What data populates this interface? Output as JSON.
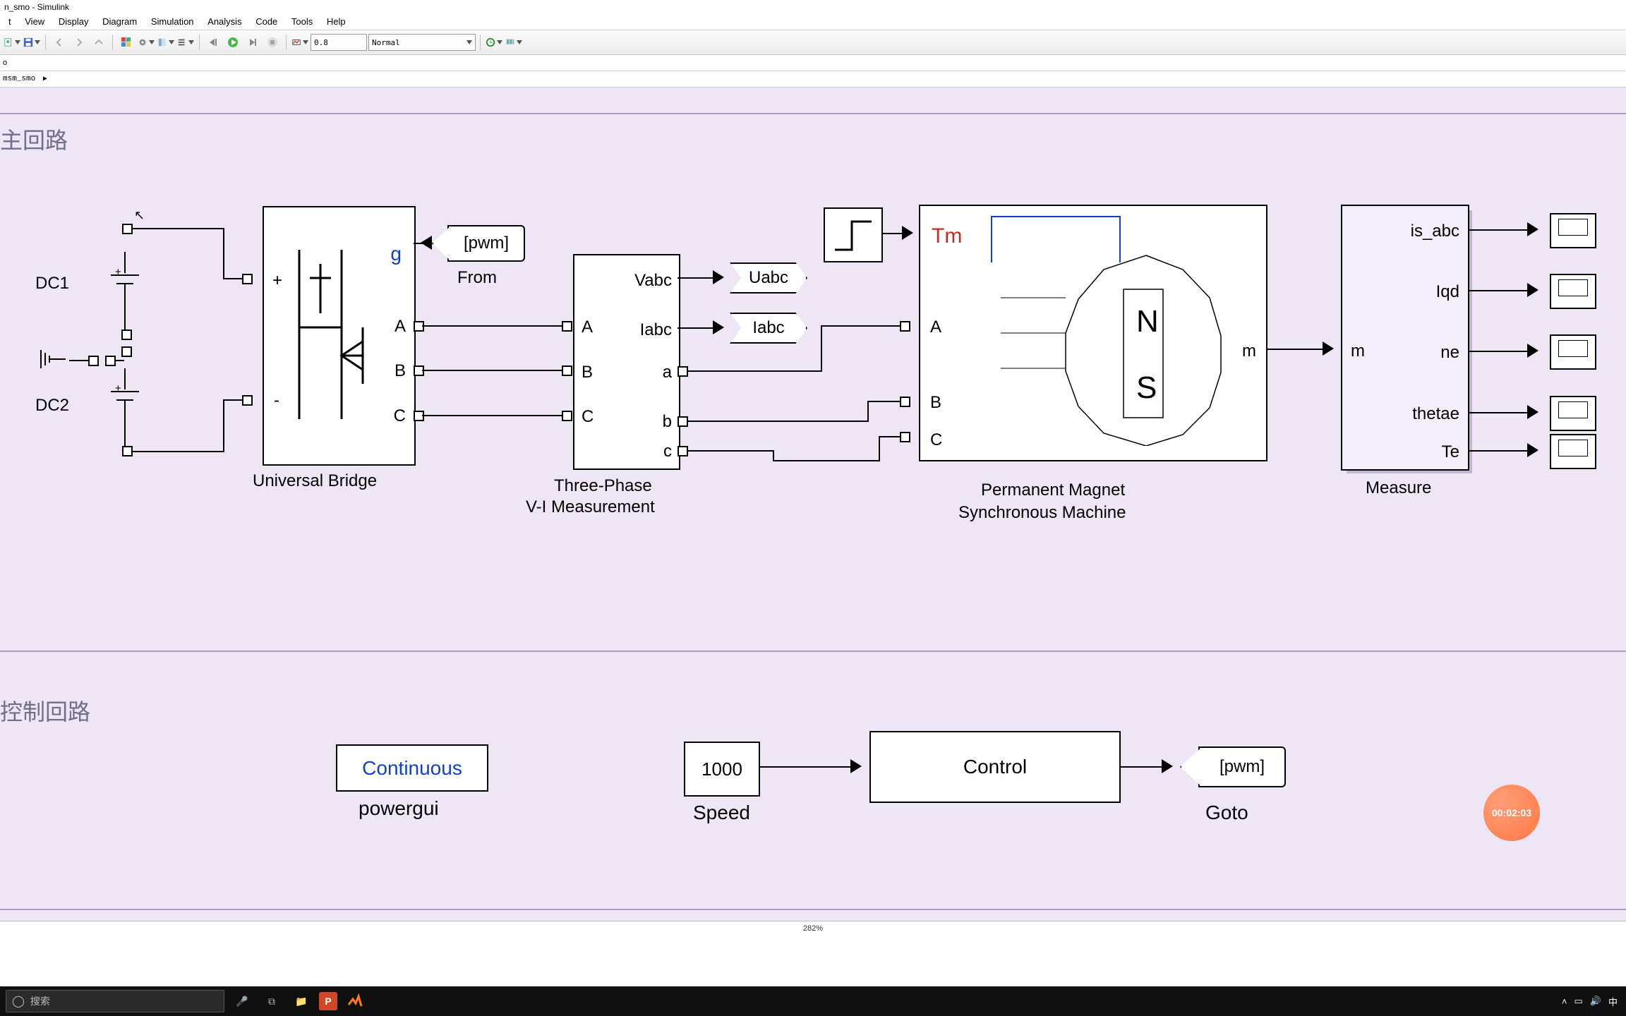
{
  "window": {
    "title": "n_smo - Simulink"
  },
  "menus": {
    "edit": "t",
    "view": "View",
    "display": "Display",
    "diagram": "Diagram",
    "simulation": "Simulation",
    "analysis": "Analysis",
    "code": "Code",
    "tools": "Tools",
    "help": "Help"
  },
  "toolbar": {
    "stop_time": "0.8",
    "mode": "Normal"
  },
  "tab": {
    "name": "o"
  },
  "breadcrumb": {
    "model": "msm_smo"
  },
  "status": {
    "zoom": "282%"
  },
  "regions": {
    "main": "主回路",
    "ctrl": "控制回路"
  },
  "labels": {
    "DC1": "DC1",
    "DC2": "DC2",
    "UniversalBridge": "Universal Bridge",
    "ThreeLine1": "Three-Phase",
    "ThreeLine2": "V-I Measurement",
    "PM1": "Permanent Magnet",
    "PM2": "Synchronous Machine",
    "Measure": "Measure",
    "powergui": "powergui",
    "Speed": "Speed",
    "Goto": "Goto",
    "From": "From"
  },
  "blocks": {
    "bridge": {
      "g": "g",
      "plus": "+",
      "minus": "-",
      "A": "A",
      "B": "B",
      "C": "C"
    },
    "vi": {
      "Vabc": "Vabc",
      "Iabc": "Iabc",
      "A": "A",
      "B": "B",
      "C": "C",
      "a": "a",
      "b": "b",
      "c": "c"
    },
    "pmsm": {
      "A": "A",
      "B": "B",
      "C": "C",
      "Tm": "Tm",
      "m": "m"
    },
    "measure": {
      "m": "m",
      "is_abc": "is_abc",
      "Iqd": "Iqd",
      "ne": "ne",
      "thetae": "thetae",
      "Te": "Te"
    },
    "powergui": "Continuous",
    "speed": "1000",
    "control": "Control"
  },
  "tags": {
    "pwm_from": "[pwm]",
    "Uabc": "Uabc",
    "Iabc": "Iabc",
    "pwm_goto": "[pwm]"
  },
  "timer": "00:02:03",
  "taskbar": {
    "search_placeholder": "搜索",
    "ime": "中"
  }
}
